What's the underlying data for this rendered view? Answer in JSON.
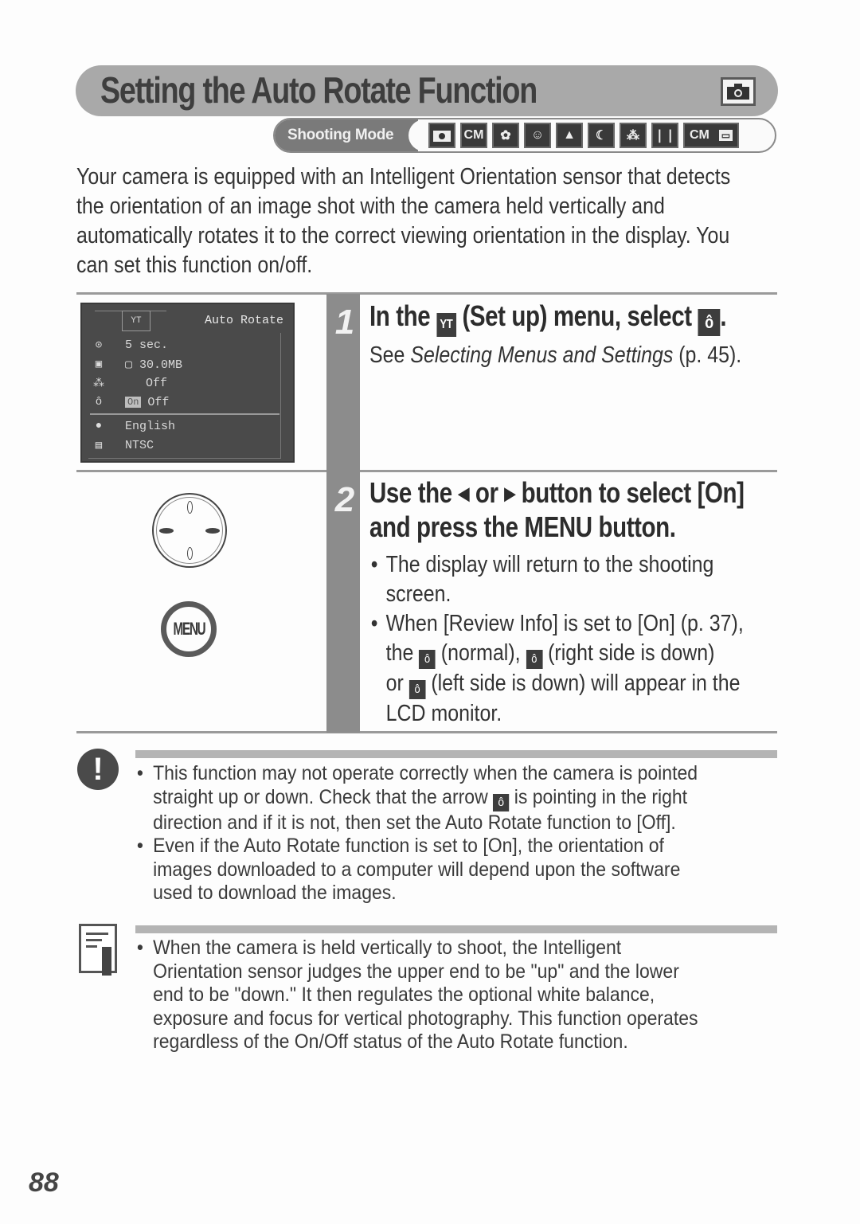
{
  "header": {
    "title": "Setting the Auto Rotate Function",
    "title_icon": "camera-icon",
    "mode_label": "Shooting Mode",
    "mode_icons": [
      "auto-icon",
      "manual-icon",
      "macro-icon",
      "portrait-icon",
      "landscape-icon",
      "night-scene-icon",
      "stitch-assist-icon",
      "fast-shutter-icon",
      "movie-icon"
    ]
  },
  "intro": {
    "lines": [
      "Your camera is equipped with an Intelligent Orientation sensor that detects",
      "the orientation of an image shot with the camera held vertically and",
      "automatically rotates it to the correct viewing orientation in the display. You",
      "can set this function on/off."
    ]
  },
  "lcd": {
    "tab_label": "YT",
    "title": "Auto Rotate",
    "rows": [
      {
        "icon": "⊙",
        "value": "5 sec."
      },
      {
        "icon": "▣",
        "value": "▢ 30.0MB"
      },
      {
        "icon": "⁂",
        "value": "Off"
      },
      {
        "icon": "ô",
        "value": "Off",
        "selected": "On"
      },
      {
        "icon": "●",
        "value": "English"
      },
      {
        "icon": "▤",
        "value": "NTSC"
      }
    ]
  },
  "steps": [
    {
      "number": "1",
      "heading_parts": [
        "In the ",
        "YT",
        " (Set up) menu, select ",
        "ô",
        "."
      ],
      "body": {
        "pre": "See ",
        "italic": "Selecting Menus and Settings",
        "post": " (p. 45)."
      }
    },
    {
      "number": "2",
      "heading_line1": {
        "pre": "Use the ",
        "left": "◀",
        "mid": " or ",
        "right": "▶",
        "post": " button to select [On]"
      },
      "heading_line2": "and press the MENU button.",
      "bullets": [
        {
          "lines": [
            "The display will return to the shooting",
            "screen."
          ]
        },
        {
          "lines": [
            "When [Review Info] is set to [On] (p. 37),"
          ],
          "line2": {
            "a": "the ",
            "b": " (normal), ",
            "c": " (right side is down)"
          },
          "line3": {
            "a": "or ",
            "b": " (left side is down) will appear in the"
          },
          "line4": "LCD monitor."
        }
      ]
    }
  ],
  "controls": {
    "menu_label": "MENU"
  },
  "caution": {
    "icon": "!",
    "bullets": [
      {
        "l1": "This function may not operate correctly when the camera is pointed",
        "l2a": "straight up or down. Check that the arrow ",
        "l2b": " is pointing in the right",
        "l3": "direction and if it is not, then set the Auto Rotate function to [Off]."
      },
      {
        "l1": "Even if the Auto Rotate function is set to [On], the orientation of",
        "l2": "images downloaded to a computer will depend upon the software",
        "l3": "used to download the images."
      }
    ]
  },
  "memo": {
    "lines": [
      "When the camera is held vertically to shoot, the Intelligent",
      "Orientation sensor judges the upper end to be \"up\" and the lower",
      "end to be \"down.\" It then regulates the optional white balance,",
      "exposure and focus for vertical photography. This function operates",
      "regardless of the On/Off status of the Auto Rotate function."
    ]
  },
  "orientation_icon_glyph": "ô",
  "page_number": "88"
}
